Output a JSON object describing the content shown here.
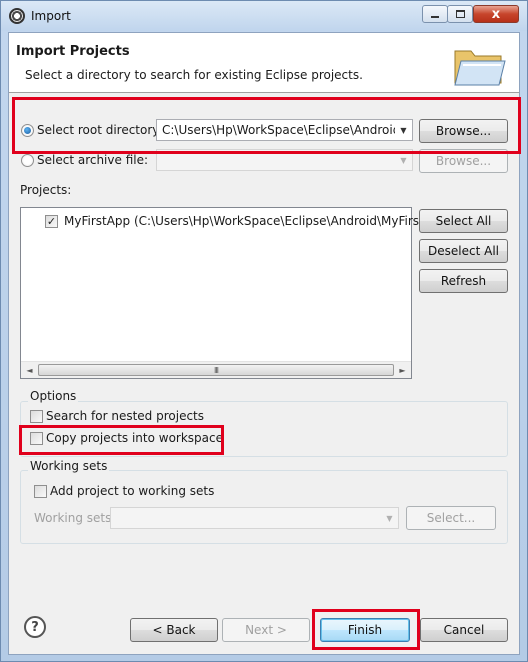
{
  "window": {
    "title": "Import",
    "close_glyph": "x"
  },
  "banner": {
    "title": "Import Projects",
    "description": "Select a directory to search for existing Eclipse projects.",
    "icon": "open-folder-icon"
  },
  "source": {
    "root_label": "Select root directory:",
    "root_value": "C:\\Users\\Hp\\WorkSpace\\Eclipse\\Android\\MyFirstApp",
    "root_browse": "Browse...",
    "archive_label": "Select archive file:",
    "archive_value": "",
    "archive_browse": "Browse..."
  },
  "projects": {
    "label": "Projects:",
    "items": [
      {
        "label": "MyFirstApp (C:\\Users\\Hp\\WorkSpace\\Eclipse\\Android\\MyFirstApp)",
        "checked": true
      }
    ],
    "select_all": "Select All",
    "deselect_all": "Deselect All",
    "refresh": "Refresh",
    "scroll_left": "◄",
    "scroll_right": "►",
    "scroll_grip": "III"
  },
  "options": {
    "caption": "Options",
    "nested": "Search for nested projects",
    "copy": "Copy projects into workspace"
  },
  "working_sets": {
    "caption": "Working sets",
    "add": "Add project to working sets",
    "sets_label": "Working sets:",
    "sets_value": "",
    "select": "Select..."
  },
  "footer": {
    "help": "?",
    "back": "< Back",
    "next": "Next >",
    "finish": "Finish",
    "cancel": "Cancel"
  },
  "colors": {
    "highlight": "#e0001c",
    "dialog_bg": "#f0f0f0",
    "frame": "#b9d1ea"
  }
}
